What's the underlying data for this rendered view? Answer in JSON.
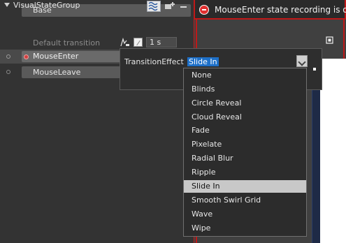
{
  "states_panel": {
    "base_state": "Base",
    "group_name": "VisualStateGroup",
    "default_transition_label": "Default transition",
    "default_transition_duration": "1 s",
    "states": [
      "MouseEnter",
      "MouseLeave"
    ]
  },
  "recording_bar": {
    "text": "MouseEnter state recording is on",
    "accent_color": "#c01818"
  },
  "transition_popup": {
    "label": "TransitionEffect",
    "selected_value": "Slide In",
    "options": [
      "None",
      "Blinds",
      "Circle Reveal",
      "Cloud Reveal",
      "Fade",
      "Pixelate",
      "Radial Blur",
      "Ripple",
      "Slide In",
      "Smooth Swirl Grid",
      "Wave",
      "Wipe"
    ],
    "highlighted_option": "Slide In"
  },
  "icons": [
    "easing-function-icon",
    "transition-effect-icon",
    "add-state-icon",
    "remove-group-icon",
    "recording-icon",
    "frame-icon",
    "chevron-down-icon"
  ]
}
